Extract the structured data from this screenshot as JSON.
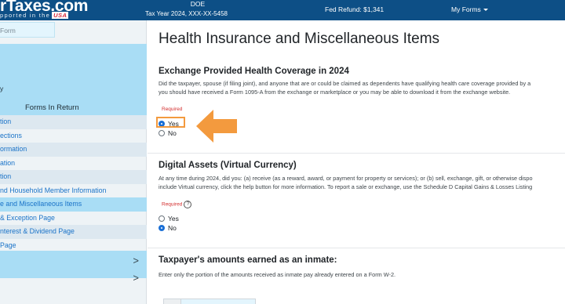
{
  "topbar": {
    "logo": "rTaxes.com",
    "logo_sub": "pported in the",
    "logo_flag": "USA",
    "taxpayer_name": "DOE",
    "tax_year": "Tax Year 2024, XXX-XX-5458",
    "refund": "Fed Refund: $1,341",
    "my_forms": "My Forms"
  },
  "sidebar": {
    "search_placeholder": "Form",
    "section_label": "y",
    "list_header": "Forms In Return",
    "items": [
      "tion",
      "ections",
      "ormation",
      "ation",
      "tion",
      "nd Household Member Information",
      "e and Miscellaneous Items",
      " & Exception Page",
      "nterest & Dividend Page",
      "Page"
    ],
    "expand_chevron_1": ">",
    "expand_chevron_2": ">"
  },
  "main": {
    "page_title": "Health Insurance and Miscellaneous Items",
    "exchange": {
      "title": "Exchange Provided Health Coverage in 2024",
      "text_line1": "Did the taxpayer, spouse (if filing joint), and anyone that are or could be claimed as dependents have qualifying health care coverage provided by a",
      "text_line2": "you should have received a Form 1095-A from the exchange or marketplace or you may be able to download it from the exchange website.",
      "required": "Required",
      "option_yes": "Yes",
      "option_no": "No",
      "selected": "Yes"
    },
    "digital": {
      "title": "Digital Assets (Virtual Currency)",
      "text_line1": "At any time during 2024, did you: (a) receive (as a reward, award, or payment for property or services); or (b) sell, exchange, gift, or otherwise dispo",
      "text_line2": "include Virtual currency, click the help button for more information. To report a sale or exchange, use the Schedule D Capital Gains & Losses Listing",
      "required": "Required",
      "help": "?",
      "option_yes": "Yes",
      "option_no": "No",
      "selected": "No"
    },
    "inmate": {
      "title": "Taxpayer's amounts earned as an inmate:",
      "text": "Enter only the portion of the amounts received as inmate pay already entered on a Form W-2."
    }
  },
  "colors": {
    "topbar": "#0d4f86",
    "sidebar_highlight": "#a9ddf5",
    "link": "#1a73c8",
    "annotation_arrow": "#f39a3e",
    "radio_selected": "#1a6fd6"
  }
}
